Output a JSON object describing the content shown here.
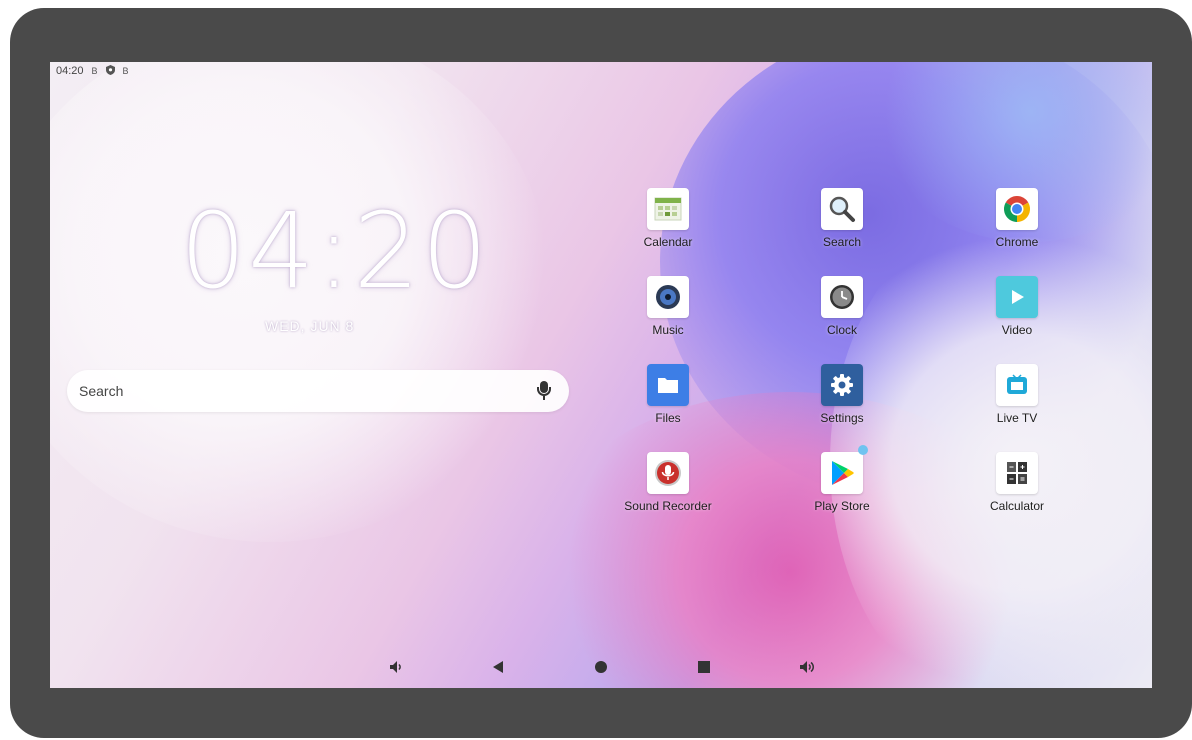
{
  "status_bar": {
    "time": "04:20",
    "icons": [
      "notification-b-icon",
      "shield-icon",
      "notification-b-icon"
    ],
    "glyphs": [
      "B",
      "B"
    ]
  },
  "home": {
    "clock_time": "04:20",
    "clock_date": "WED, JUN 8",
    "search_placeholder": "Search"
  },
  "apps": [
    {
      "label": "Calendar",
      "icon": "calendar-icon"
    },
    {
      "label": "Search",
      "icon": "magnifier-icon"
    },
    {
      "label": "Chrome",
      "icon": "chrome-icon"
    },
    {
      "label": "Music",
      "icon": "music-icon"
    },
    {
      "label": "Clock",
      "icon": "clock-icon"
    },
    {
      "label": "Video",
      "icon": "play-icon"
    },
    {
      "label": "Files",
      "icon": "folder-icon"
    },
    {
      "label": "Settings",
      "icon": "gear-icon"
    },
    {
      "label": "Live TV",
      "icon": "tv-icon"
    },
    {
      "label": "Sound Recorder",
      "icon": "microphone-icon"
    },
    {
      "label": "Play Store",
      "icon": "play-store-icon"
    },
    {
      "label": "Calculator",
      "icon": "calculator-icon"
    }
  ],
  "nav_bar": {
    "items": [
      "volume-down-icon",
      "back-icon",
      "home-icon",
      "recents-icon",
      "volume-up-icon"
    ]
  },
  "colors": {
    "bezel": "#4a4a4a",
    "settings_tile": "#2f5f9e",
    "files_tile": "#3d7ee6",
    "video_tile": "#4ec9dd",
    "notification_dot": "#6fc3f0"
  }
}
